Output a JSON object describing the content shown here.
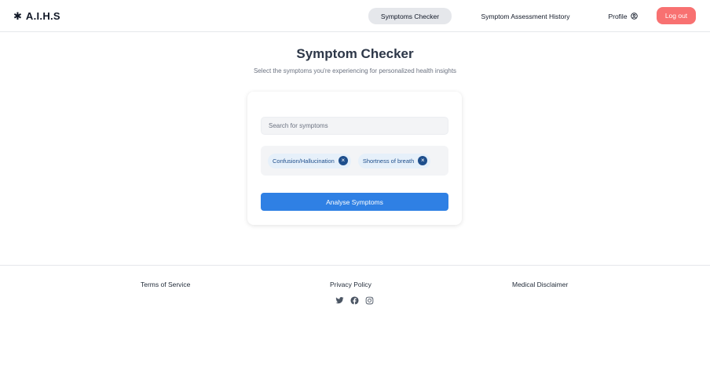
{
  "header": {
    "brand_icon": "✱",
    "brand": "A.I.H.S",
    "nav": {
      "checker": "Symptoms Checker",
      "history": "Symptom Assessment History",
      "profile": "Profile"
    },
    "logout": "Log out"
  },
  "main": {
    "title": "Symptom Checker",
    "subtitle": "Select the symptoms you're experiencing for personalized health insights",
    "search_placeholder": "Search for symptoms",
    "selected_symptoms": [
      {
        "label": "Confusion/Hallucination",
        "remove_icon": "close-icon"
      },
      {
        "label": "Shortness of breath",
        "remove_icon": "close-icon"
      }
    ],
    "remove_glyph": "×",
    "analyse_button": "Analyse Symptoms"
  },
  "footer": {
    "links": [
      "Terms of Service",
      "Privacy Policy",
      "Medical Disclaimer"
    ],
    "social_icons": [
      "twitter-icon",
      "facebook-icon",
      "instagram-icon"
    ]
  },
  "colors": {
    "accent": "#2f80e4",
    "logout": "#f87171",
    "chip_bg": "#e6f0fa",
    "chip_text": "#1e4e8c",
    "active_nav_bg": "#e5e7eb"
  }
}
